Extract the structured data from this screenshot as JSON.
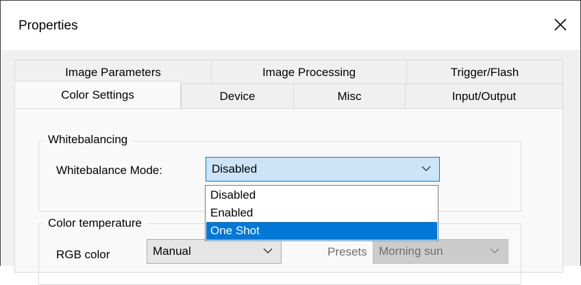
{
  "window": {
    "title": "Properties"
  },
  "tabs": {
    "row1": [
      {
        "label": "Image Parameters"
      },
      {
        "label": "Image Processing"
      },
      {
        "label": "Trigger/Flash"
      }
    ],
    "row2": [
      {
        "label": "Color Settings",
        "selected": true
      },
      {
        "label": "Device"
      },
      {
        "label": "Misc"
      },
      {
        "label": "Input/Output"
      }
    ]
  },
  "whitebalancing": {
    "group_label": "Whitebalancing",
    "mode_label": "Whitebalance Mode:",
    "mode_value": "Disabled",
    "options": [
      "Disabled",
      "Enabled",
      "One Shot"
    ],
    "highlighted_option": "One Shot"
  },
  "color_temperature": {
    "group_label": "Color temperature",
    "rgb_label": "RGB color",
    "rgb_value": "Manual",
    "presets_label": "Presets",
    "presets_value": "Morning sun"
  },
  "colors": {
    "selection_blue": "#0078d7",
    "combo_focus_bg": "#cce4f7",
    "combo_focus_border": "#0078d7",
    "disabled_text": "#6d6d6d"
  }
}
